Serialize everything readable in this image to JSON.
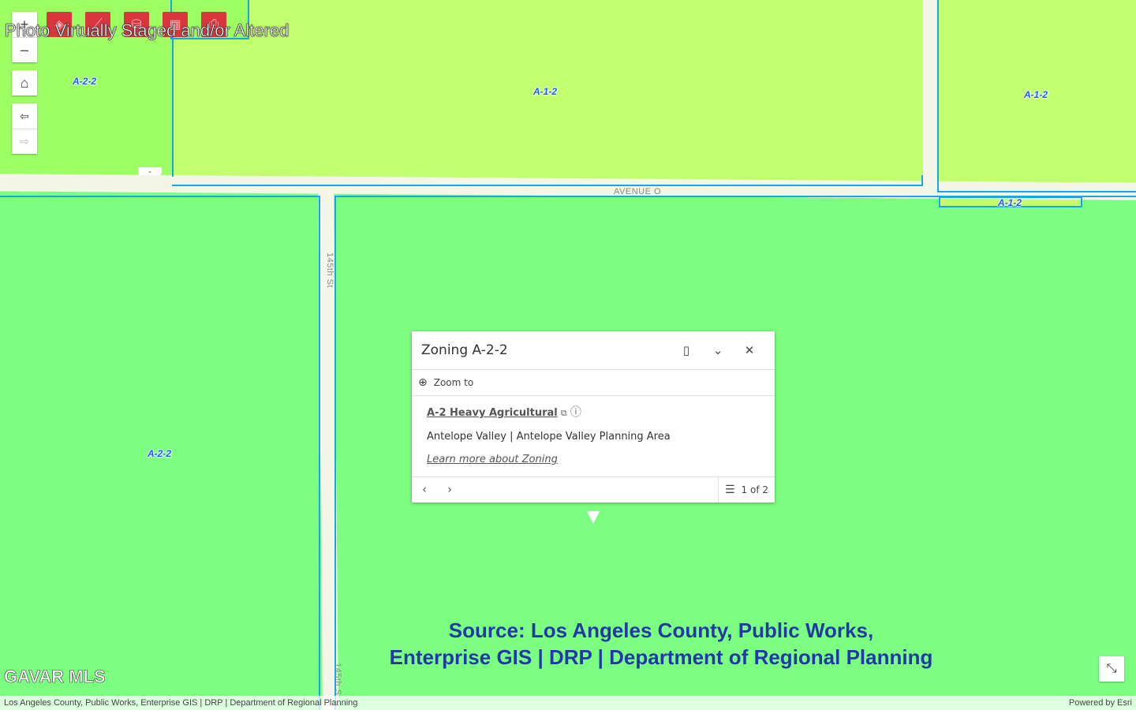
{
  "map": {
    "zone_labels": [
      "A-2-2",
      "A-1-2",
      "A-1-2",
      "A-2-2",
      "A-1-2"
    ],
    "street_labels": [
      "AVENUE O",
      "145th St",
      "145th St"
    ],
    "colors": {
      "zone_a1": "#c2ff6e",
      "zone_a2": "#7cff80",
      "zone_a2_light": "#9dff62",
      "boundary": "#1aa6e6",
      "road": "#f4f6e8"
    }
  },
  "overlay": {
    "notice": "Photo Virtually Staged and/or Altered",
    "watermark": "GAVAR MLS",
    "source_line1": "Source: Los Angeles County, Public Works,",
    "source_line2": "Enterprise GIS | DRP | Department of Regional Planning"
  },
  "controls": {
    "zoom_in": "+",
    "zoom_out": "–",
    "home_icon": "home-icon",
    "back_icon": "back-arrow-icon",
    "forward_icon": "forward-arrow-icon",
    "tool_icons": [
      "layers-icon",
      "measure-icon",
      "database-icon",
      "basemap-icon",
      "print-icon"
    ],
    "tool_color": "#d9363e"
  },
  "popup": {
    "title": "Zoning A-2-2",
    "zoom_to": "Zoom to",
    "zone_link": "A-2 Heavy Agricultural",
    "area": "Antelope Valley | Antelope Valley Planning Area",
    "learn_more": "Learn more about Zoning",
    "pager": "1 of 2"
  },
  "attribution": {
    "left": "Los Angeles County, Public Works, Enterprise GIS | DRP | Department of Regional Planning",
    "right": "Powered by Esri"
  }
}
